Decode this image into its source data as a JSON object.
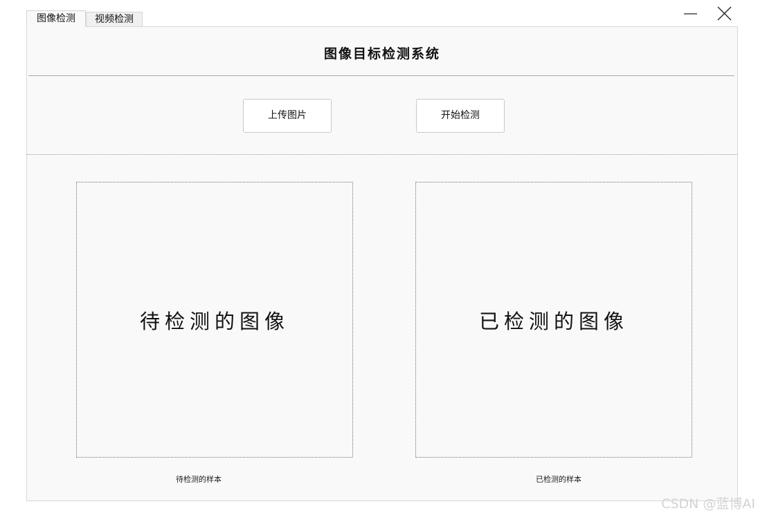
{
  "tabs": [
    {
      "label": "图像检测",
      "active": true
    },
    {
      "label": "视频检测",
      "active": false
    }
  ],
  "window": {
    "minimize_icon": "minimize-icon",
    "close_icon": "close-icon"
  },
  "header": {
    "title": "图像目标检测系统"
  },
  "toolbar": {
    "upload_label": "上传图片",
    "detect_label": "开始检测"
  },
  "images": {
    "input_placeholder": "待检测的图像",
    "output_placeholder": "已检测的图像",
    "input_caption": "待检测的样本",
    "output_caption": "已检测的样本"
  },
  "watermark": "CSDN @蓝博AI"
}
